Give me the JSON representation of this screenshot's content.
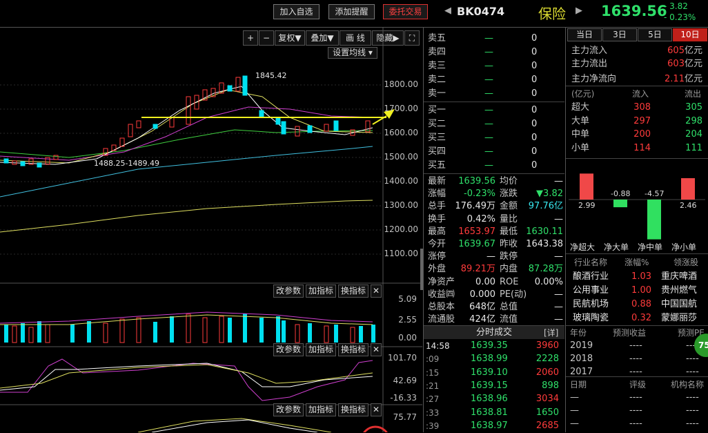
{
  "header": {
    "add_watch": "加入自选",
    "add_alert": "添加提醒",
    "trade": "委托交易",
    "code": "BK0474",
    "name": "保险",
    "price": "1639.56",
    "change": "- 3.82",
    "change_pct": "- 0.23%"
  },
  "toolbar": {
    "plus": "+",
    "minus": "−",
    "fuquan": "复权▼",
    "diejia": "叠加▼",
    "huaxian": "画 线",
    "yincang": "隐藏▶",
    "expand": "⛶",
    "ma_setting": "设置均线",
    "sub_params": "改参数",
    "sub_add": "加指标",
    "sub_switch": "换指标",
    "sub_close": "✕"
  },
  "main_axis": [
    "1800.00",
    "1700.00",
    "1600.00",
    "1500.00",
    "1400.00",
    "1300.00",
    "1200.00",
    "1100.00"
  ],
  "annotations": {
    "high": "1845.42",
    "low": "1488.25-1489.49"
  },
  "vol_axis": [
    "5.09",
    "2.55",
    "0.00"
  ],
  "kdj_axis": [
    "101.70",
    "42.69",
    "-16.33"
  ],
  "macd_axis": [
    "75.77"
  ],
  "order_book": {
    "sell": [
      [
        "卖五",
        "—",
        "0"
      ],
      [
        "卖四",
        "—",
        "0"
      ],
      [
        "卖三",
        "—",
        "0"
      ],
      [
        "卖二",
        "—",
        "0"
      ],
      [
        "卖一",
        "—",
        "0"
      ]
    ],
    "buy": [
      [
        "买一",
        "—",
        "0"
      ],
      [
        "买二",
        "—",
        "0"
      ],
      [
        "买三",
        "—",
        "0"
      ],
      [
        "买四",
        "—",
        "0"
      ],
      [
        "买五",
        "—",
        "0"
      ]
    ]
  },
  "stats": [
    {
      "l1": "最新",
      "v1": "1639.56",
      "c1": "grn",
      "l2": "均价",
      "v2": "—",
      "c2": "wht"
    },
    {
      "l1": "涨幅",
      "v1": "-0.23%",
      "c1": "grn",
      "l2": "涨跌",
      "v2": "▼3.82",
      "c2": "grn"
    },
    {
      "l1": "总手",
      "v1": "176.49万",
      "c1": "wht",
      "l2": "金额",
      "v2": "97.76亿",
      "c2": "cyan"
    },
    {
      "l1": "换手",
      "v1": "0.42%",
      "c1": "wht",
      "l2": "量比",
      "v2": "—",
      "c2": "wht"
    },
    {
      "l1": "最高",
      "v1": "1653.97",
      "c1": "red",
      "l2": "最低",
      "v2": "1630.11",
      "c2": "grn"
    },
    {
      "l1": "今开",
      "v1": "1639.67",
      "c1": "grn",
      "l2": "昨收",
      "v2": "1643.38",
      "c2": "wht"
    },
    {
      "l1": "涨停",
      "v1": "—",
      "c1": "wht",
      "l2": "跌停",
      "v2": "—",
      "c2": "wht"
    },
    {
      "l1": "外盘",
      "v1": "89.21万",
      "c1": "red",
      "l2": "内盘",
      "v2": "87.28万",
      "c2": "grn"
    },
    {
      "l1": "净资产",
      "v1": "0.00",
      "c1": "wht",
      "l2": "ROE",
      "v2": "0.00%",
      "c2": "wht"
    },
    {
      "l1": "收益㈣",
      "v1": "0.000",
      "c1": "wht",
      "l2": "PE(动)",
      "v2": "—",
      "c2": "wht"
    },
    {
      "l1": "总股本",
      "v1": "648亿",
      "c1": "wht",
      "l2": "总值",
      "v2": "—",
      "c2": "wht"
    },
    {
      "l1": "流通股",
      "v1": "424亿",
      "c1": "wht",
      "l2": "流值",
      "v2": "—",
      "c2": "wht"
    }
  ],
  "ticks": {
    "title": "分时成交",
    "detail": "[详]",
    "rows": [
      [
        "14:58",
        "1639.35",
        "3960"
      ],
      [
        ":09",
        "1638.99",
        "2228"
      ],
      [
        ":15",
        "1639.10",
        "2060"
      ],
      [
        ":21",
        "1639.15",
        "898"
      ],
      [
        ":27",
        "1638.96",
        "3034"
      ],
      [
        ":33",
        "1638.81",
        "1650"
      ],
      [
        ":39",
        "1638.97",
        "2685"
      ]
    ]
  },
  "flow": {
    "tabs": [
      "当日",
      "3日",
      "5日",
      "10日"
    ],
    "inflow_label": "主力流入",
    "inflow": "605",
    "unit": "亿元",
    "outflow_label": "主力流出",
    "outflow": "603",
    "net_label": "主力净流向",
    "net": "2.11",
    "table_head": [
      "(亿元)",
      "流入",
      "流出"
    ],
    "rows": [
      [
        "超大",
        "308",
        "305"
      ],
      [
        "大单",
        "297",
        "298"
      ],
      [
        "中单",
        "200",
        "204"
      ],
      [
        "小单",
        "114",
        "111"
      ]
    ],
    "bars": {
      "labels": [
        "净超大",
        "净大单",
        "净中单",
        "净小单"
      ],
      "values": [
        2.99,
        -0.88,
        -4.57,
        2.46
      ],
      "texts": [
        "2.99",
        "-0.88",
        "-4.57",
        "2.46"
      ]
    }
  },
  "industry": {
    "head": [
      "行业名称",
      "涨幅%",
      "领涨股"
    ],
    "rows": [
      [
        "酿酒行业",
        "1.03",
        "重庆啤酒"
      ],
      [
        "公用事业",
        "1.00",
        "贵州燃气"
      ],
      [
        "民航机场",
        "0.88",
        "中国国航"
      ],
      [
        "玻璃陶瓷",
        "0.32",
        "蒙娜丽莎"
      ]
    ]
  },
  "forecast": {
    "head": [
      "年份",
      "预测收益",
      "预测PE"
    ],
    "rows": [
      [
        "2019",
        "----",
        "----"
      ],
      [
        "2018",
        "----",
        "----"
      ],
      [
        "2017",
        "----",
        "----"
      ]
    ],
    "head2": [
      "日期",
      "评级",
      "机构名称"
    ],
    "rows2": [
      [
        "—",
        "----",
        "----"
      ],
      [
        "—",
        "----",
        "----"
      ],
      [
        "—",
        "----",
        "----"
      ]
    ],
    "badge": "75"
  }
}
